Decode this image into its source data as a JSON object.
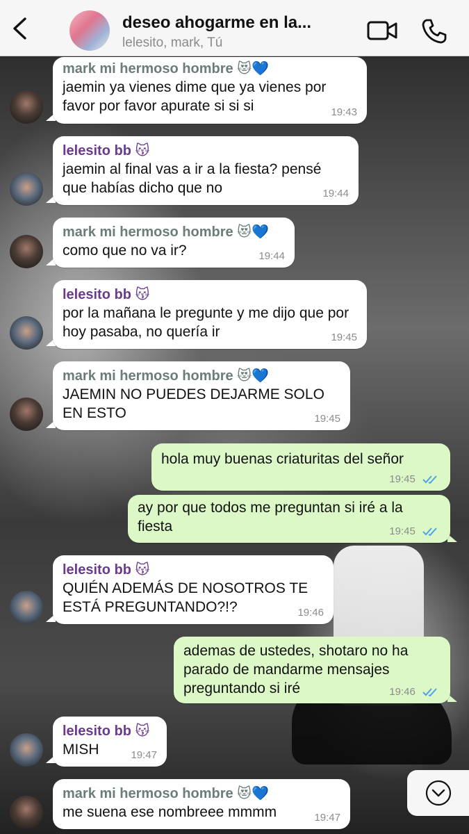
{
  "header": {
    "title": "deseo ahogarme en la...",
    "subtitle": "lelesito, mark, Tú",
    "back_icon": "chevron-left-icon",
    "video_icon": "video-camera-icon",
    "phone_icon": "phone-icon"
  },
  "colors": {
    "incoming_bubble": "#ffffff",
    "outgoing_bubble": "#dcf8c6",
    "mark_name": "#6b7d7a",
    "lele_name": "#6a3a8b",
    "read_ticks": "#4fa3e8"
  },
  "messages": [
    {
      "sender": "mark mi hermoso hombre 😻💙",
      "text": "jaemin ya vienes dime que ya vienes por favor por favor apurate si si si",
      "time": "19:43"
    },
    {
      "sender": "lelesito bb 😽",
      "text": "jaemin al final vas a ir a la fiesta? pensé que habías dicho que no",
      "time": "19:44"
    },
    {
      "sender": "mark mi hermoso hombre 😻💙",
      "text": "como que no va ir?",
      "time": "19:44"
    },
    {
      "sender": "lelesito bb 😽",
      "text": "por la mañana le pregunte y me dijo que por hoy pasaba, no quería ir",
      "time": "19:45"
    },
    {
      "sender": "mark mi hermoso hombre 😻💙",
      "text": "JAEMIN NO PUEDES DEJARME SOLO EN ESTO",
      "time": "19:45"
    },
    {
      "text": "hola muy buenas criaturitas del señor",
      "time": "19:45"
    },
    {
      "text": "ay por que todos me preguntan si iré a la fiesta",
      "time": "19:45"
    },
    {
      "sender": "lelesito bb 😽",
      "text": "QUIÉN ADEMÁS DE NOSOTROS TE ESTÁ PREGUNTANDO?!?",
      "time": "19:46"
    },
    {
      "text": "ademas de ustedes, shotaro no ha parado de mandarme mensajes preguntando si iré",
      "time": "19:46"
    },
    {
      "sender": "lelesito bb 😽",
      "text": "MISH",
      "time": "19:47"
    },
    {
      "sender": "mark mi hermoso hombre 😻💙",
      "text": "me suena ese nombreee mmmm",
      "time": "19:47"
    }
  ],
  "scroll_button_icon": "chevron-down-circle-icon"
}
